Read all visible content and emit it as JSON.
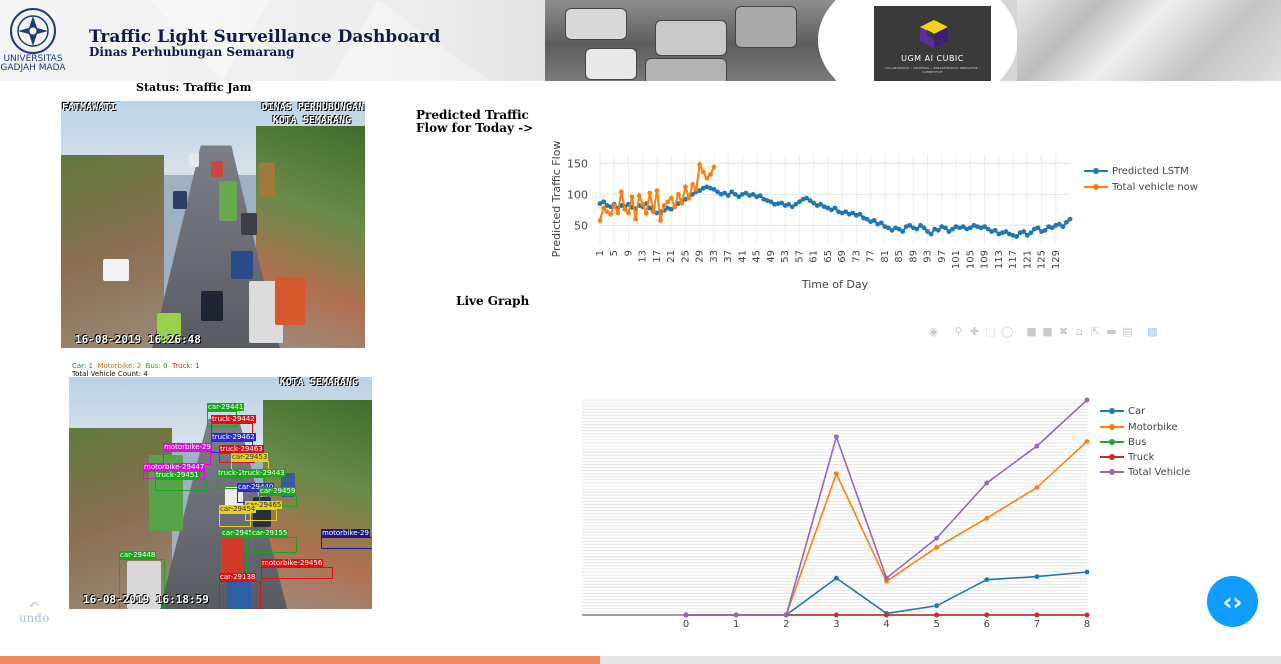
{
  "header": {
    "title": "Traffic Light Surveillance Dashboard",
    "subtitle": "Dinas Perhubungan Semarang",
    "university": {
      "line1": "UNIVERSITAS",
      "line2": "GADJAH MADA"
    },
    "partner_logo": {
      "name": "UGM AI CUBIC",
      "tagline": "COLLABORATIVE • UNIVERSAL • BREAKTHROUGH INNOVATIVE • COMPETITIVE"
    }
  },
  "status": "Status: Traffic Jam",
  "camera_raw": {
    "location_label": "FATMAWATI",
    "agency_label_1": "DINAS PERHUBUNGAN",
    "agency_label_2": "KOTA SEMARANG",
    "timestamp": "16-08-2019 16:26:48"
  },
  "camera_detect": {
    "counts": {
      "car": "Car: 1",
      "motorbike": "Motorbike: 2",
      "bus": "Bus: 0",
      "truck": "Truck: 1"
    },
    "total": "Total Vehicle Count: 4",
    "agency_label": "KOTA SEMARANG",
    "timestamp": "16-08-2019 16:18:59",
    "detections": [
      {
        "label": "car-29441",
        "color": "#16a816"
      },
      {
        "label": "truck-29442",
        "color": "#e01010"
      },
      {
        "label": "truck-29462",
        "color": "#2a2ad8"
      },
      {
        "label": "motorbike-29",
        "color": "#d414d4"
      },
      {
        "label": "truck-29463",
        "color": "#e01010"
      },
      {
        "label": "car-29453",
        "color": "#e3d31a"
      },
      {
        "label": "motorbike-29447",
        "color": "#d414d4"
      },
      {
        "label": "truck-29451",
        "color": "#16a816"
      },
      {
        "label": "truck-29444",
        "color": "#16a816"
      },
      {
        "label": "truck-29443",
        "color": "#16a816"
      },
      {
        "label": "car-29440",
        "color": "#2a2ad8"
      },
      {
        "label": "car-29459",
        "color": "#16a816"
      },
      {
        "label": "car-29465",
        "color": "#e3d31a"
      },
      {
        "label": "car-29454",
        "color": "#e3d31a"
      },
      {
        "label": "car-29458",
        "color": "#16a816"
      },
      {
        "label": "car-29155",
        "color": "#16a816"
      },
      {
        "label": "motorbike-29",
        "color": "#1a1a8a"
      },
      {
        "label": "car-29448",
        "color": "#16a816"
      },
      {
        "label": "motorbike-29456",
        "color": "#e01010"
      },
      {
        "label": "car-29138",
        "color": "#e01010"
      }
    ]
  },
  "captions": {
    "predicted": [
      "Predicted Traffic",
      "Flow for Today ->"
    ],
    "live": "Live Graph"
  },
  "modebar": {
    "icons": [
      "camera-icon",
      "zoom-icon",
      "pan-icon",
      "box-select-icon",
      "lasso-icon",
      "zoom-in-icon",
      "zoom-out-icon",
      "autoscale-icon",
      "reset-axes-icon",
      "spike-lines-icon",
      "hover-closest-icon",
      "hover-compare-icon",
      "plotly-logo-icon"
    ]
  },
  "undo_label": "undo",
  "progress_fraction": 0.468,
  "chart_data": [
    {
      "type": "line",
      "title": "",
      "xlabel": "Time of Day",
      "ylabel": "Predicted Traffic Flow",
      "xlim": [
        1,
        133
      ],
      "ylim": [
        20,
        165
      ],
      "ytick_labels": [
        "50",
        "100",
        "150"
      ],
      "ytick_values": [
        50,
        100,
        150
      ],
      "xtick_labels": [
        "1",
        "5",
        "9",
        "13",
        "17",
        "21",
        "25",
        "29",
        "33",
        "37",
        "41",
        "45",
        "49",
        "53",
        "57",
        "61",
        "65",
        "69",
        "73",
        "77",
        "81",
        "85",
        "89",
        "93",
        "97",
        "101",
        "105",
        "109",
        "113",
        "117",
        "121",
        "125",
        "129"
      ],
      "legend_position": "right",
      "grid": true,
      "series": [
        {
          "name": "Predicted LSTM",
          "color": "#1f77b4",
          "x": [
            1,
            2,
            3,
            4,
            5,
            6,
            7,
            8,
            9,
            10,
            11,
            12,
            13,
            14,
            15,
            16,
            17,
            18,
            19,
            20,
            21,
            22,
            23,
            24,
            25,
            26,
            27,
            28,
            29,
            30,
            31,
            32,
            33,
            34,
            35,
            36,
            37,
            38,
            39,
            40,
            41,
            42,
            43,
            44,
            45,
            46,
            47,
            48,
            49,
            50,
            51,
            52,
            53,
            54,
            55,
            56,
            57,
            58,
            59,
            60,
            61,
            62,
            63,
            64,
            65,
            66,
            67,
            68,
            69,
            70,
            71,
            72,
            73,
            74,
            75,
            76,
            77,
            78,
            79,
            80,
            81,
            82,
            83,
            84,
            85,
            86,
            87,
            88,
            89,
            90,
            91,
            92,
            93,
            94,
            95,
            96,
            97,
            98,
            99,
            100,
            101,
            102,
            103,
            104,
            105,
            106,
            107,
            108,
            109,
            110,
            111,
            112,
            113,
            114,
            115,
            116,
            117,
            118,
            119,
            120,
            121,
            122,
            123,
            124,
            125,
            126,
            127,
            128,
            129,
            130,
            131,
            132,
            133
          ],
          "y": [
            85,
            88,
            82,
            80,
            84,
            78,
            82,
            80,
            84,
            79,
            77,
            82,
            80,
            85,
            78,
            72,
            70,
            72,
            74,
            78,
            76,
            80,
            85,
            90,
            92,
            96,
            100,
            104,
            106,
            110,
            112,
            110,
            108,
            104,
            100,
            102,
            98,
            104,
            100,
            96,
            100,
            102,
            98,
            100,
            96,
            98,
            92,
            90,
            88,
            84,
            85,
            86,
            82,
            84,
            80,
            84,
            88,
            92,
            94,
            90,
            86,
            82,
            84,
            80,
            78,
            75,
            78,
            72,
            70,
            72,
            68,
            70,
            66,
            68,
            62,
            60,
            56,
            58,
            52,
            54,
            48,
            46,
            42,
            46,
            44,
            40,
            48,
            50,
            46,
            44,
            50,
            46,
            40,
            36,
            44,
            42,
            48,
            46,
            40,
            44,
            48,
            46,
            48,
            44,
            46,
            50,
            48,
            46,
            48,
            44,
            40,
            42,
            36,
            38,
            40,
            36,
            34,
            32,
            38,
            40,
            34,
            38,
            44,
            46,
            40,
            42,
            48,
            46,
            50,
            52,
            48,
            55,
            60
          ]
        },
        {
          "name": "Total vehicle now",
          "color": "#ff7f0e",
          "x": [
            1,
            2,
            3,
            4,
            5,
            6,
            7,
            8,
            9,
            10,
            11,
            12,
            13,
            14,
            15,
            16,
            17,
            18,
            19,
            20,
            21,
            22,
            23,
            24,
            25,
            26,
            27,
            28,
            29,
            30,
            31,
            32,
            33
          ],
          "y": [
            58,
            78,
            72,
            68,
            82,
            70,
            104,
            76,
            70,
            96,
            60,
            98,
            84,
            70,
            102,
            72,
            106,
            58,
            82,
            88,
            94,
            80,
            100,
            86,
            112,
            94,
            116,
            108,
            148,
            136,
            126,
            132,
            144
          ]
        }
      ]
    },
    {
      "type": "line",
      "title": "",
      "xlabel": "",
      "ylabel": "",
      "xlim": [
        0,
        8
      ],
      "xtick_labels": [
        "0",
        "1",
        "2",
        "3",
        "4",
        "5",
        "6",
        "7",
        "8"
      ],
      "ylim": [
        0,
        14
      ],
      "legend_position": "right",
      "grid": true,
      "series": [
        {
          "name": "Car",
          "color": "#1f77b4",
          "x": [
            0,
            1,
            2,
            3,
            4,
            5,
            6,
            7,
            8
          ],
          "y": [
            0,
            0,
            0,
            2.4,
            0.1,
            0.6,
            2.3,
            2.5,
            2.8
          ]
        },
        {
          "name": "Motorbike",
          "color": "#ff7f0e",
          "x": [
            0,
            1,
            2,
            3,
            4,
            5,
            6,
            7,
            8
          ],
          "y": [
            0,
            0,
            0,
            9.2,
            2.2,
            4.4,
            6.3,
            8.3,
            11.3
          ]
        },
        {
          "name": "Bus",
          "color": "#2ca02c",
          "x": [
            0,
            1,
            2,
            3,
            4,
            5,
            6,
            7,
            8
          ],
          "y": [
            0,
            0,
            0,
            0,
            0,
            0,
            0,
            0,
            0
          ]
        },
        {
          "name": "Truck",
          "color": "#d62728",
          "x": [
            0,
            1,
            2,
            3,
            4,
            5,
            6,
            7,
            8
          ],
          "y": [
            0,
            0,
            0,
            0,
            0,
            0,
            0,
            0,
            0
          ]
        },
        {
          "name": "Total Vehicle",
          "color": "#9467bd",
          "x": [
            0,
            1,
            2,
            3,
            4,
            5,
            6,
            7,
            8
          ],
          "y": [
            0,
            0,
            0,
            11.6,
            2.4,
            5.0,
            8.6,
            11.0,
            14.0
          ]
        }
      ]
    }
  ]
}
